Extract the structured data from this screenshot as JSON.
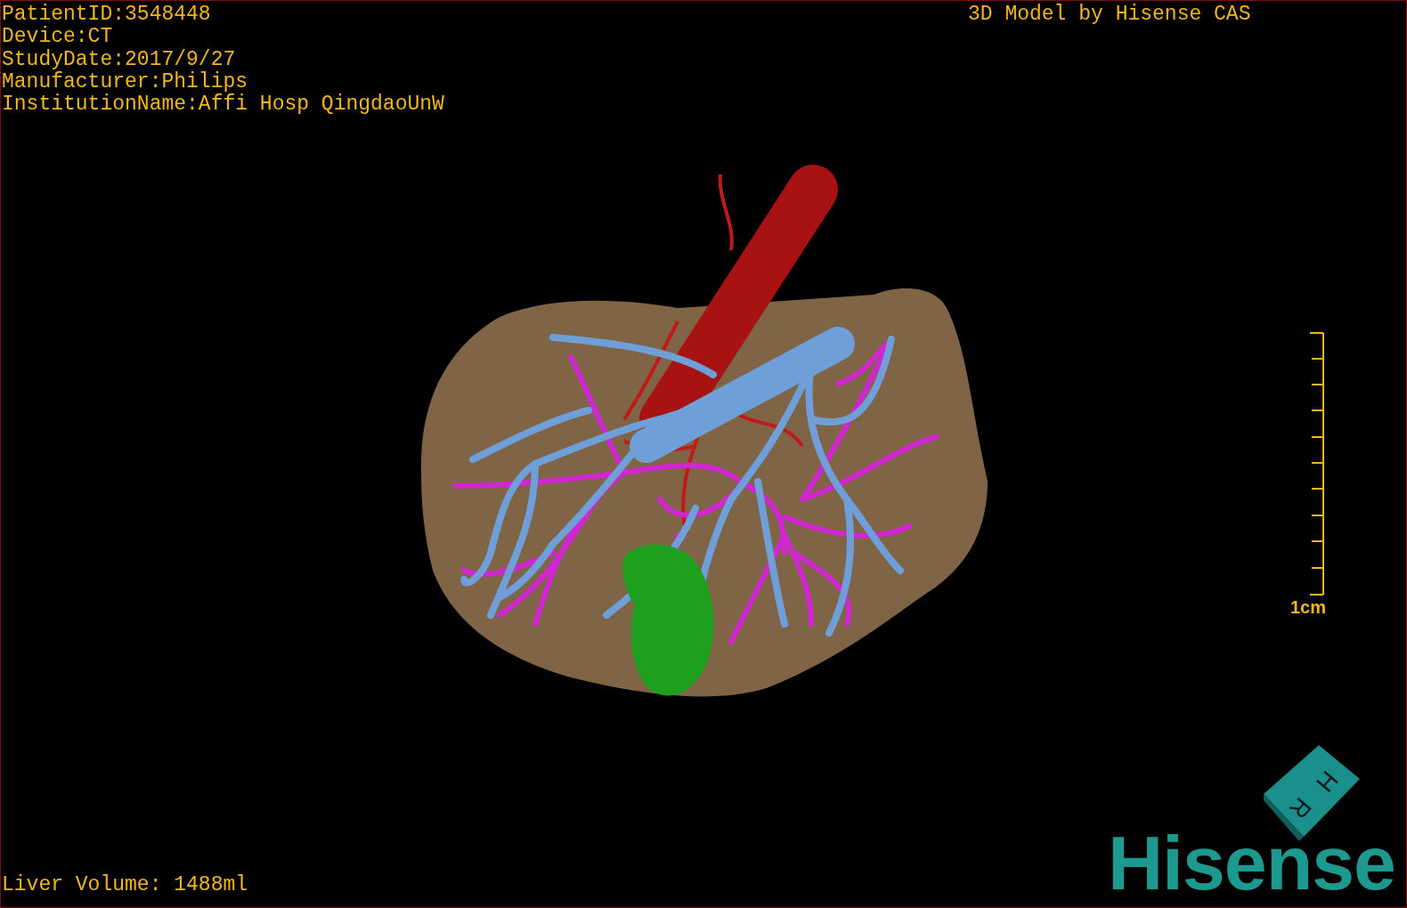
{
  "info_lines": [
    "PatientID:3548448",
    "Device:CT",
    "StudyDate:2017/9/27",
    "Manufacturer:Philips",
    "InstitutionName:Affi Hosp QingdaoUnW"
  ],
  "title": "3D Model by Hisense CAS",
  "scale_bar": {
    "label": "1cm"
  },
  "orientation_cube": {
    "faces": [
      "H",
      "R"
    ]
  },
  "volume": "Liver Volume: 1488ml",
  "logo": "Hisense"
}
